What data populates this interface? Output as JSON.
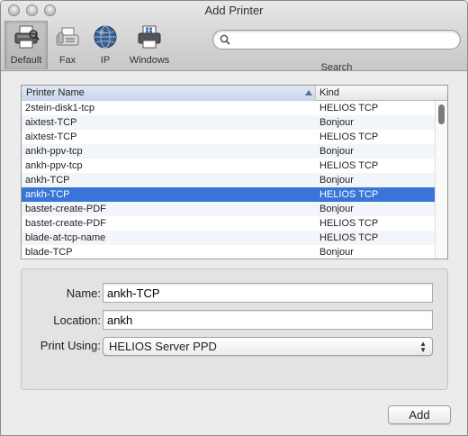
{
  "window": {
    "title": "Add Printer"
  },
  "toolbar": {
    "items": [
      {
        "label": "Default",
        "icon": "printer-icon"
      },
      {
        "label": "Fax",
        "icon": "fax-icon"
      },
      {
        "label": "IP",
        "icon": "globe-icon"
      },
      {
        "label": "Windows",
        "icon": "windows-printer-icon"
      }
    ],
    "selected": "Default",
    "search": {
      "value": "",
      "placeholder": "",
      "label": "Search"
    }
  },
  "printer_list": {
    "columns": [
      "Printer Name",
      "Kind"
    ],
    "sort_column": "Printer Name",
    "sort_direction": "ascending",
    "rows": [
      {
        "name": "2stein-disk1-tcp",
        "kind": "HELIOS TCP"
      },
      {
        "name": "aixtest-TCP",
        "kind": "Bonjour"
      },
      {
        "name": "aixtest-TCP",
        "kind": "HELIOS TCP"
      },
      {
        "name": "ankh-ppv-tcp",
        "kind": "Bonjour"
      },
      {
        "name": "ankh-ppv-tcp",
        "kind": "HELIOS TCP"
      },
      {
        "name": "ankh-TCP",
        "kind": "Bonjour"
      },
      {
        "name": "ankh-TCP",
        "kind": "HELIOS TCP"
      },
      {
        "name": "bastet-create-PDF",
        "kind": "Bonjour"
      },
      {
        "name": "bastet-create-PDF",
        "kind": "HELIOS TCP"
      },
      {
        "name": "blade-at-tcp-name",
        "kind": "HELIOS TCP"
      },
      {
        "name": "blade-TCP",
        "kind": "Bonjour"
      }
    ],
    "selected_index": 6
  },
  "form": {
    "name_label": "Name:",
    "name_value": "ankh-TCP",
    "location_label": "Location:",
    "location_value": "ankh",
    "print_using_label": "Print Using:",
    "print_using_value": "HELIOS Server PPD"
  },
  "actions": {
    "add_label": "Add"
  },
  "colors": {
    "selection": "#3875d7",
    "alt_row": "#f2f5fa"
  }
}
